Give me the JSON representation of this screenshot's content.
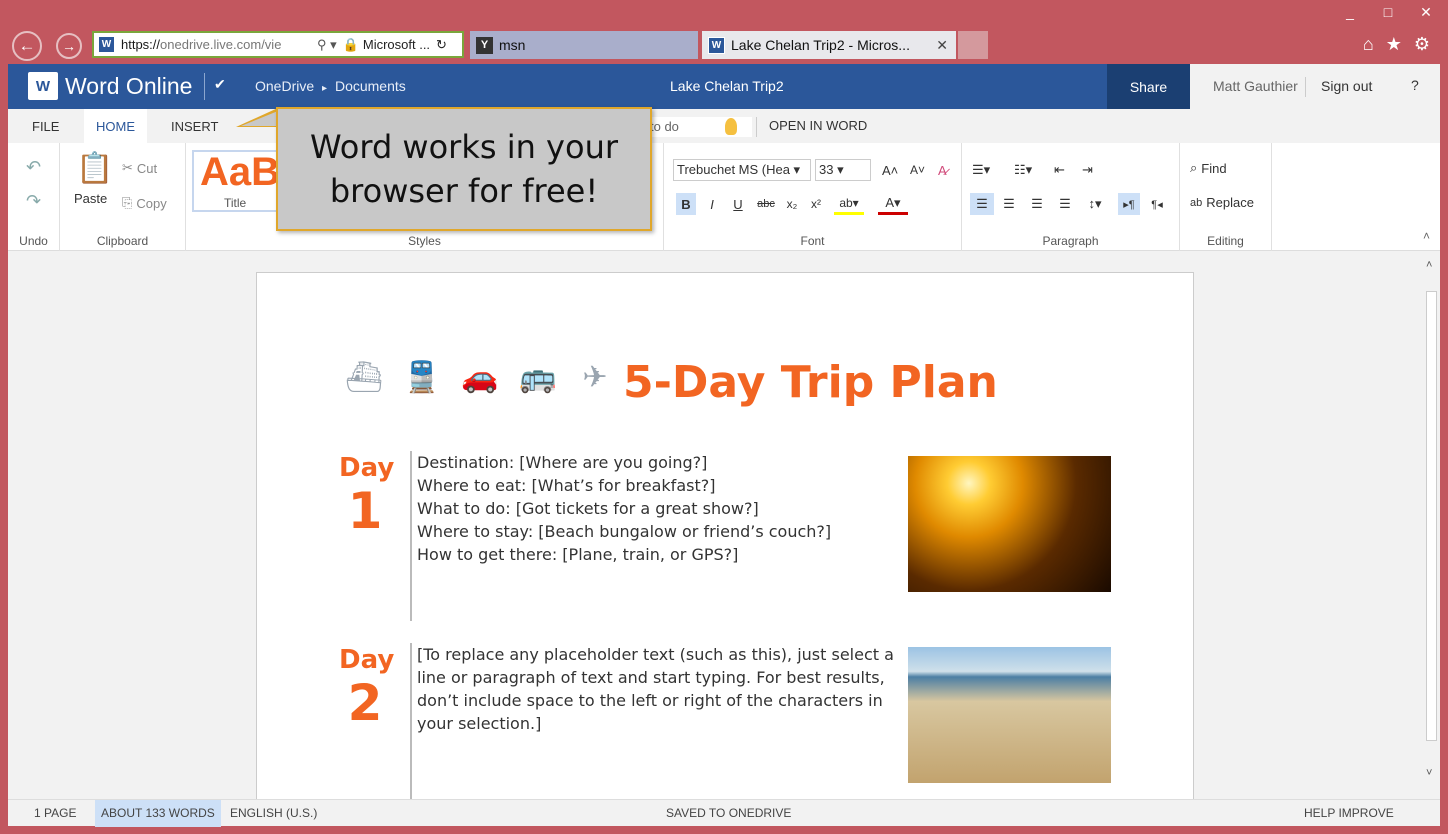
{
  "window": {
    "minimize": "_",
    "maximize": "□",
    "close": "✕"
  },
  "browser": {
    "url_prefix": "https://",
    "url_domain": "onedrive.live.com/vie",
    "search_symbol": "⚲ ▾",
    "site_name": "Microsoft ...",
    "refresh_symbol": "↻",
    "tabs": [
      {
        "label": "msn"
      },
      {
        "label": "Lake Chelan Trip2 - Micros..."
      }
    ],
    "right_icons": [
      "⌂",
      "★",
      "⚙"
    ]
  },
  "app": {
    "name": "Word Online",
    "logo": "W",
    "breadcrumb_root": "OneDrive",
    "breadcrumb_sep": "▸",
    "breadcrumb_folder": "Documents",
    "doc_title": "Lake Chelan Trip2",
    "share": "Share",
    "user": "Matt Gauthier",
    "signout": "Sign out",
    "help": "?"
  },
  "ribbon_tabs": [
    "FILE",
    "HOME",
    "INSERT"
  ],
  "tellme": "to do",
  "open_in_word": "OPEN IN WORD",
  "ribbon": {
    "undo_group": "Undo",
    "clipboard_group": "Clipboard",
    "paste": "Paste",
    "cut": "Cut",
    "copy": "Copy",
    "styles_group": "Styles",
    "style_sample": "AaB",
    "style_name": "Title",
    "font_group": "Font",
    "font_name": "Trebuchet MS (Hea ▾",
    "font_size": "33 ▾",
    "paragraph_group": "Paragraph",
    "editing_group": "Editing",
    "find": "Find",
    "replace": "Replace"
  },
  "callout": "Word works in your browser for free!",
  "document": {
    "title": "5-Day Trip Plan",
    "days": [
      {
        "word": "Day",
        "num": "1",
        "lines": [
          "Destination: [Where are you going?]",
          "Where to eat: [What’s for breakfast?]",
          "What to do: [Got tickets for a great show?]",
          "Where to stay: [Beach bungalow or friend’s couch?]",
          "How to get there: [Plane, train, or GPS?]"
        ]
      },
      {
        "word": "Day",
        "num": "2",
        "lines": [
          "[To replace any placeholder text (such as this), just select a",
          "line or paragraph of text and start typing. For best results,",
          "don’t include space to the left or right of the characters in",
          "your selection.]"
        ]
      }
    ]
  },
  "status": {
    "pages": "1 PAGE",
    "words": "ABOUT 133 WORDS",
    "lang": "ENGLISH (U.S.)",
    "saved": "SAVED TO ONEDRIVE",
    "help": "HELP IMPROVE OFFICE"
  }
}
